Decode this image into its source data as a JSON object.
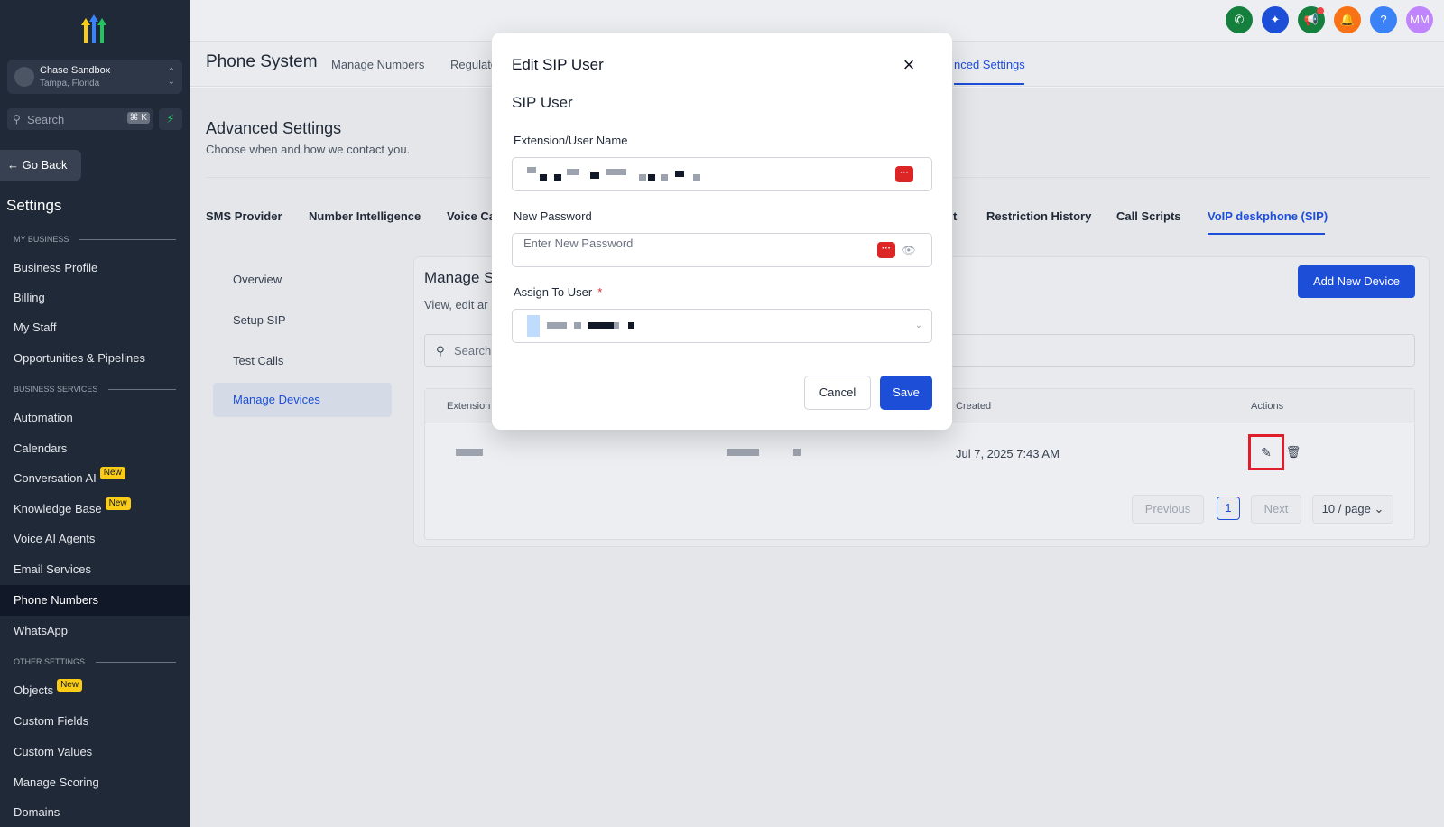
{
  "sidebar": {
    "account": {
      "name": "Chase Sandbox",
      "location": "Tampa, Florida"
    },
    "search": {
      "placeholder": "Search",
      "shortcut": "⌘ K"
    },
    "go_back": "Go Back",
    "title": "Settings",
    "sections": {
      "my_business": "MY BUSINESS",
      "business_services": "BUSINESS SERVICES",
      "other_settings": "OTHER SETTINGS"
    },
    "items": [
      {
        "label": "Business Profile"
      },
      {
        "label": "Billing"
      },
      {
        "label": "My Staff"
      },
      {
        "label": "Opportunities & Pipelines"
      },
      {
        "label": "Automation"
      },
      {
        "label": "Calendars"
      },
      {
        "label": "Conversation AI",
        "badge": "New"
      },
      {
        "label": "Knowledge Base",
        "badge": "New"
      },
      {
        "label": "Voice AI Agents"
      },
      {
        "label": "Email Services"
      },
      {
        "label": "Phone Numbers",
        "active": true
      },
      {
        "label": "WhatsApp"
      },
      {
        "label": "Objects",
        "badge": "New"
      },
      {
        "label": "Custom Fields"
      },
      {
        "label": "Custom Values"
      },
      {
        "label": "Manage Scoring"
      },
      {
        "label": "Domains"
      }
    ]
  },
  "topbar": {
    "avatar": "MM",
    "help": "?",
    "colors": {
      "phone": "#15803d",
      "magic": "#1d4ed8",
      "announce": "#15803d",
      "bell": "#f97316",
      "help": "#3b82f6",
      "avatar": "#c084fc"
    }
  },
  "header": {
    "title": "Phone System",
    "subtabs": [
      "Manage Numbers",
      "Regulato",
      "nced Settings"
    ]
  },
  "advanced": {
    "title": "Advanced Settings",
    "subtitle": "Choose when and how we contact you.",
    "tabs": [
      "SMS Provider",
      "Number Intelligence",
      "Voice Ca",
      "t",
      "Restriction History",
      "Call Scripts",
      "VoIP deskphone (SIP)"
    ]
  },
  "left_menu": [
    "Overview",
    "Setup SIP",
    "Test Calls",
    "Manage Devices"
  ],
  "panel": {
    "title": "Manage S",
    "subtitle": "View, edit ar",
    "add_button": "Add New Device",
    "search_placeholder": "Search",
    "columns": {
      "extension": "Extension",
      "created": "Created",
      "actions": "Actions"
    },
    "row": {
      "created": "Jul 7, 2025 7:43 AM"
    },
    "pagination": {
      "previous": "Previous",
      "page": "1",
      "next": "Next",
      "per_page": "10 / page"
    }
  },
  "modal": {
    "title": "Edit SIP User",
    "section": "SIP User",
    "fields": {
      "extension_label": "Extension/User Name",
      "password_label": "New Password",
      "password_placeholder": "Enter New Password",
      "assign_label": "Assign To User",
      "required_mark": "*"
    },
    "cancel": "Cancel",
    "save": "Save"
  }
}
